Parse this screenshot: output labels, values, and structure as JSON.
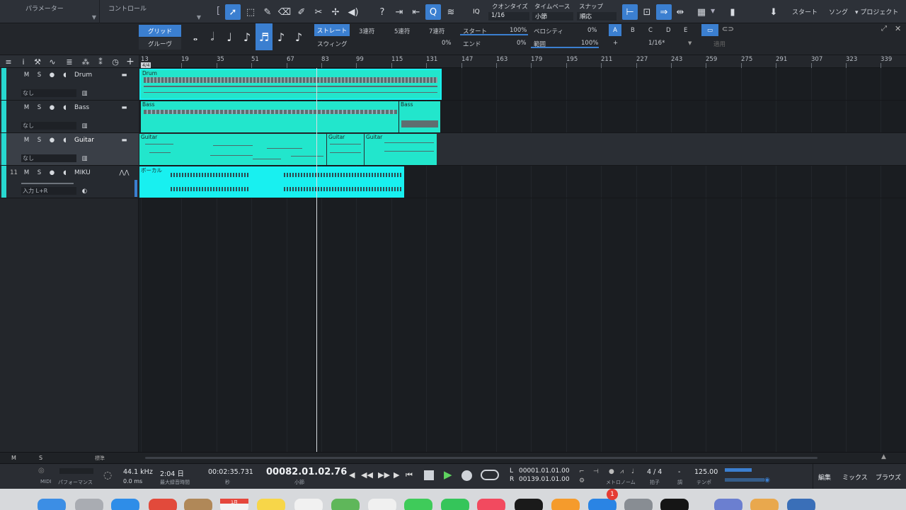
{
  "toolbar": {
    "tab_params": "パラメーター",
    "tab_control": "コントロール",
    "quantize_label": "クオンタイズ",
    "quantize_value": "1/16",
    "timebase_label": "タイムベース",
    "timebase_value": "小節",
    "snap_label": "スナップ",
    "snap_value": "順応",
    "iq": "IQ",
    "start": "スタート",
    "song": "ソング",
    "project": "プロジェクト"
  },
  "qbar": {
    "grid": "グリッド",
    "groove": "グルーヴ",
    "straight": "ストレート",
    "triplet3": "3連符",
    "triplet5": "5連符",
    "triplet7": "7連符",
    "swing": "スウィング",
    "swing_val": "0%",
    "start_label": "スタート",
    "start_val": "100%",
    "end_label": "エンド",
    "end_val": "0%",
    "velocity_label": "ベロシティ",
    "velocity_val": "0%",
    "range_label": "範囲",
    "range_val": "100%",
    "presets": [
      "A",
      "B",
      "C",
      "D",
      "E"
    ],
    "plus": "+",
    "division": "1/16*",
    "apply": "適用"
  },
  "tracks": [
    {
      "name": "Drum",
      "sub": "なし",
      "number": ""
    },
    {
      "name": "Bass",
      "sub": "なし",
      "number": ""
    },
    {
      "name": "Guitar",
      "sub": "なし",
      "number": ""
    },
    {
      "name": "MIKU",
      "sub": "入力 L+R",
      "number": "11"
    }
  ],
  "track_buttons": {
    "mute": "M",
    "solo": "S"
  },
  "ruler": {
    "ticks": [
      "13",
      "19",
      "35",
      "51",
      "67",
      "83",
      "99",
      "115",
      "131",
      "147",
      "163",
      "179",
      "195",
      "211",
      "227",
      "243",
      "259",
      "275",
      "291",
      "307",
      "323",
      "339"
    ],
    "signature": "4/4"
  },
  "clips": {
    "drum": "Drum",
    "bass1": "Bass",
    "bass2": "Bass",
    "guitar1": "Guitar",
    "guitar2": "Guitar",
    "guitar3": "Guitar",
    "vocal": "ボーカル"
  },
  "bottom": {
    "m": "M",
    "s": "S",
    "standard": "標準"
  },
  "transport": {
    "midi": "MIDI",
    "performance": "パフォーマンス",
    "sample_rate": "44.1 kHz",
    "latency": "0.0 ms",
    "record_time": "2:04 日",
    "record_time_label": "最大録音時間",
    "seconds": "00:02:35.731",
    "seconds_label": "秒",
    "bars": "00082.01.02.76",
    "bars_label": "小節",
    "loop_l_label": "L",
    "loop_l": "00001.01.01.00",
    "loop_r_label": "R",
    "loop_r": "00139.01.01.00",
    "metronome": "メトロノーム",
    "timesig": "4 / 4",
    "timesig_label": "拍子",
    "key": "-",
    "key_label": "調",
    "tempo": "125.00",
    "tempo_label": "テンポ",
    "edit": "編集",
    "mix": "ミックス",
    "browse": "ブラウズ"
  },
  "dock": {
    "calendar": "1月",
    "badge": "1"
  },
  "colors": {
    "accent": "#3b7fd0",
    "clip_teal": "#22e6cc",
    "clip_cyan": "#18f0f0",
    "track_strip": "#27d8d0"
  }
}
